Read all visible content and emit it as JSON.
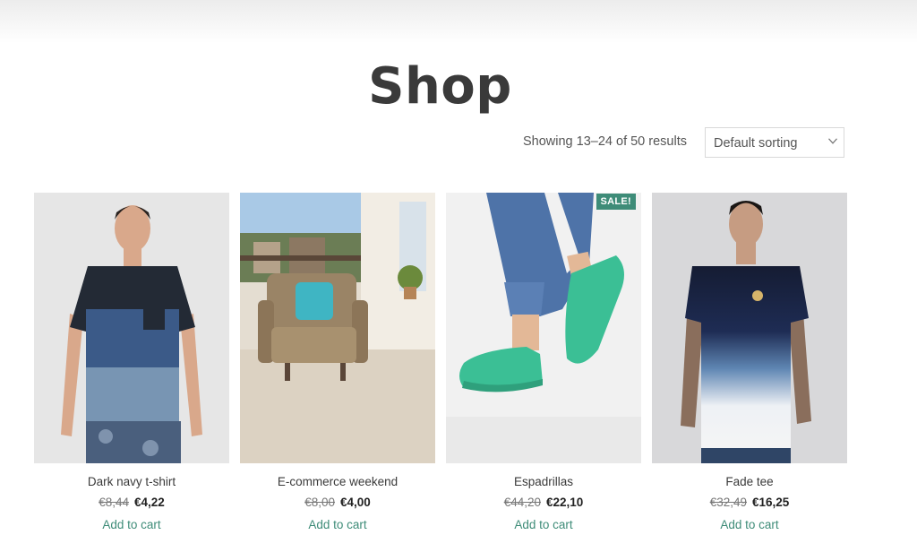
{
  "page": {
    "title": "Shop"
  },
  "toolbar": {
    "result_count": "Showing 13–24 of 50 results",
    "sort_selected": "Default sorting"
  },
  "products": [
    {
      "name": "Dark navy t-shirt",
      "old_price": "€8,44",
      "price": "€4,22",
      "cta": "Add to cart"
    },
    {
      "name": "E-commerce weekend",
      "old_price": "€8,00",
      "price": "€4,00",
      "cta": "Add to cart"
    },
    {
      "name": "Espadrillas",
      "old_price": "€44,20",
      "price": "€22,10",
      "cta": "Add to cart",
      "badge": "SALE!"
    },
    {
      "name": "Fade tee",
      "old_price": "€32,49",
      "price": "€16,25",
      "cta": "Add to cart"
    }
  ],
  "colors": {
    "accent": "#3e8c78",
    "title": "#3a3a3a"
  }
}
